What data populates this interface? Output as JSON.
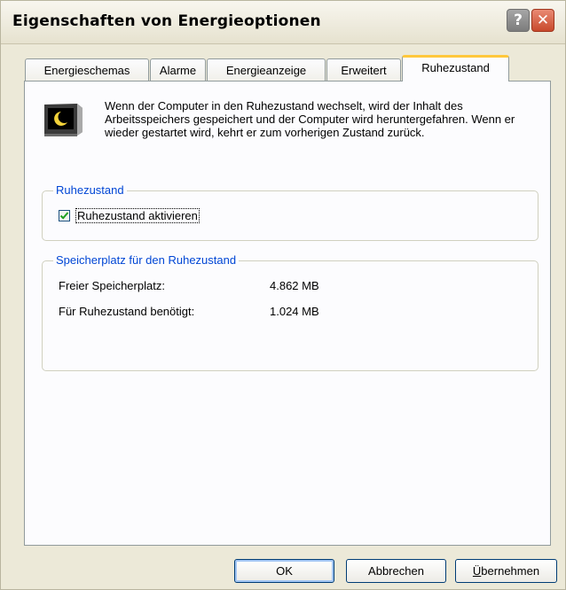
{
  "window": {
    "title": "Eigenschaften von Energieoptionen"
  },
  "titlebar": {
    "help_glyph": "?",
    "close_glyph": "✕"
  },
  "tabs": [
    {
      "label": "Energieschemas"
    },
    {
      "label": "Alarme"
    },
    {
      "label": "Energieanzeige"
    },
    {
      "label": "Erweitert"
    },
    {
      "label": "Ruhezustand",
      "active": true
    }
  ],
  "intro": {
    "icon": "hibernate-monitor-icon",
    "text": "Wenn der Computer in den Ruhezustand wechselt, wird der Inhalt des Arbeitsspeichers gespeichert und der Computer wird heruntergefahren. Wenn er wieder gestartet wird, kehrt er zum vorherigen Zustand zurück."
  },
  "hibernate_group": {
    "title": "Ruhezustand",
    "checkbox_label": "Ruhezustand aktivieren",
    "checked": true
  },
  "disk_group": {
    "title": "Speicherplatz für den Ruhezustand",
    "free_label": "Freier Speicherplatz:",
    "free_value": "4.862 MB",
    "required_label": "Für Ruhezustand benötigt:",
    "required_value": "1.024 MB"
  },
  "buttons": {
    "ok": "OK",
    "cancel": "Abbrechen",
    "apply_underlined": "Ü",
    "apply_rest": "bernehmen"
  },
  "colors": {
    "group_title": "#0046d5",
    "active_tab_accent": "#ffc83c",
    "check_mark": "#21a121"
  }
}
